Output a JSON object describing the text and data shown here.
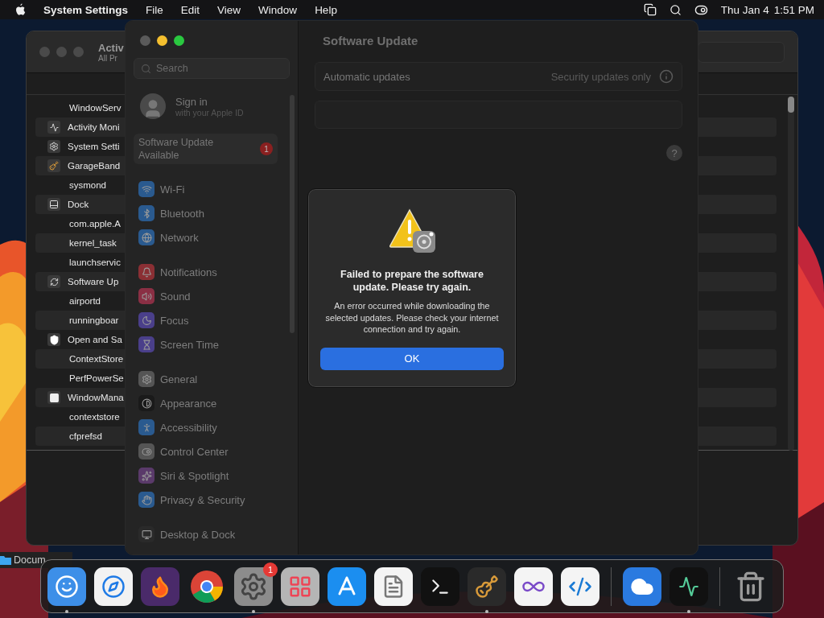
{
  "menu_bar": {
    "app_name": "System Settings",
    "menus": [
      "File",
      "Edit",
      "View",
      "Window",
      "Help"
    ],
    "date": "Thu Jan 4",
    "time": "1:51 PM"
  },
  "activity_monitor": {
    "title": "Activ",
    "subtitle": "All Pr",
    "processes": [
      {
        "name": "WindowServ",
        "kind": "none"
      },
      {
        "name": "Activity Moni",
        "kind": "activity"
      },
      {
        "name": "System Setti",
        "kind": "settings"
      },
      {
        "name": "GarageBand",
        "kind": "garageband"
      },
      {
        "name": "sysmond",
        "kind": "none"
      },
      {
        "name": "Dock",
        "kind": "dock"
      },
      {
        "name": "com.apple.A",
        "kind": "none"
      },
      {
        "name": "kernel_task",
        "kind": "none"
      },
      {
        "name": "launchservic",
        "kind": "none"
      },
      {
        "name": "Software Up",
        "kind": "update"
      },
      {
        "name": "airportd",
        "kind": "none"
      },
      {
        "name": "runningboar",
        "kind": "none"
      },
      {
        "name": "Open and Sa",
        "kind": "shield"
      },
      {
        "name": "ContextStore",
        "kind": "none"
      },
      {
        "name": "PerfPowerSe",
        "kind": "none"
      },
      {
        "name": "WindowMana",
        "kind": "window"
      },
      {
        "name": "contextstore",
        "kind": "none"
      },
      {
        "name": "cfprefsd",
        "kind": "none"
      }
    ]
  },
  "finder_window": {
    "title": "Docum"
  },
  "settings": {
    "search": {
      "placeholder": "Search"
    },
    "account": {
      "title": "Sign in",
      "subtitle": "with your Apple ID"
    },
    "update_notice": {
      "label": "Software Update Available",
      "badge": "1"
    },
    "sidebar_groups": [
      {
        "items": [
          {
            "label": "Wi-Fi",
            "kind": "wifi",
            "color": "#2a5a8f"
          },
          {
            "label": "Bluetooth",
            "kind": "bluetooth",
            "color": "#2a5a8f"
          },
          {
            "label": "Network",
            "kind": "network",
            "color": "#2a5a8f"
          }
        ]
      },
      {
        "items": [
          {
            "label": "Notifications",
            "kind": "notifications",
            "color": "#8a2f34"
          },
          {
            "label": "Sound",
            "kind": "sound",
            "color": "#8a2f44"
          },
          {
            "label": "Focus",
            "kind": "focus",
            "color": "#4a3f8a"
          },
          {
            "label": "Screen Time",
            "kind": "screen_time",
            "color": "#4a3f8a"
          }
        ]
      },
      {
        "items": [
          {
            "label": "General",
            "kind": "general",
            "color": "#555555"
          },
          {
            "label": "Appearance",
            "kind": "appearance",
            "color": "#1a1a1a"
          },
          {
            "label": "Accessibility",
            "kind": "accessibility",
            "color": "#2a5a8f"
          },
          {
            "label": "Control Center",
            "kind": "control_center",
            "color": "#555555"
          },
          {
            "label": "Siri & Spotlight",
            "kind": "siri",
            "color": "#5a3a6a"
          },
          {
            "label": "Privacy & Security",
            "kind": "privacy",
            "color": "#2a5a8f"
          }
        ]
      },
      {
        "items": [
          {
            "label": "Desktop & Dock",
            "kind": "desktop",
            "color": "#2a2a2a"
          }
        ]
      }
    ],
    "page_title": "Software Update",
    "rows": [
      {
        "label": "Automatic updates",
        "value": "Security updates only"
      }
    ],
    "help": "?"
  },
  "dialog": {
    "title": "Failed to prepare the software update. Please try again.",
    "message": "An error occurred while downloading the selected updates. Please check your internet connection and try again.",
    "button": "OK"
  },
  "dock": {
    "apps": [
      {
        "kind": "finder",
        "running": true
      },
      {
        "kind": "safari",
        "running": false
      },
      {
        "kind": "firefox",
        "running": false
      },
      {
        "kind": "chrome",
        "running": false
      },
      {
        "kind": "settings",
        "running": true,
        "badge": "1"
      },
      {
        "kind": "launchpad",
        "running": false
      },
      {
        "kind": "appstore",
        "running": false
      },
      {
        "kind": "textedit",
        "running": false
      },
      {
        "kind": "terminal",
        "running": false
      },
      {
        "kind": "garageband",
        "running": true
      },
      {
        "kind": "visualstudio",
        "running": false
      },
      {
        "kind": "vscode",
        "running": false
      },
      {
        "kind": "separator"
      },
      {
        "kind": "weather",
        "running": false
      },
      {
        "kind": "activitymonitor",
        "running": true
      },
      {
        "kind": "separator"
      },
      {
        "kind": "trash",
        "running": false
      }
    ]
  }
}
